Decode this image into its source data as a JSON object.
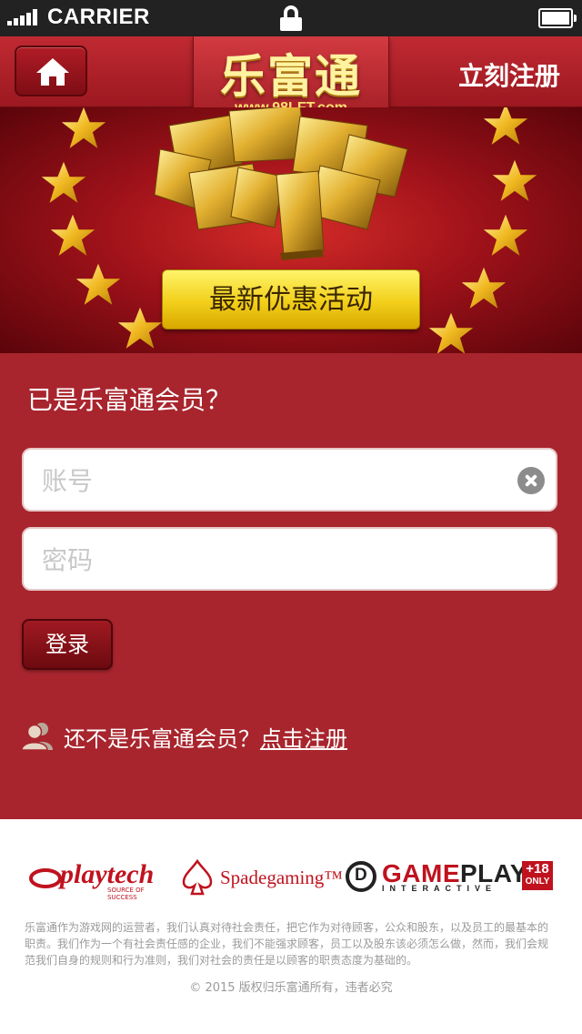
{
  "status_bar": {
    "carrier": "CARRIER"
  },
  "header": {
    "logo_text": "乐富通",
    "logo_url": "www.98LFT.com",
    "register_label": "立刻注册"
  },
  "banner": {
    "promo_label": "最新优惠活动"
  },
  "login": {
    "title": "已是乐富通会员？",
    "account_placeholder": "账号",
    "password_placeholder": "密码",
    "login_label": "登录",
    "not_member_text": "还不是乐富通会员？",
    "register_link": "点击注册"
  },
  "footer": {
    "partners": {
      "playtech": "playtech",
      "playtech_tagline": "SOURCE OF SUCCESS",
      "spadegaming": "Spadegaming™",
      "gameplay_word1": "GAME",
      "gameplay_word2": "PLAY",
      "gameplay_sub": "INTERACTIVE",
      "age_number": "+18",
      "age_label": "ONLY"
    },
    "disclaimer": "乐富通作为游戏网的运营者，我们认真对待社会责任，把它作为对待顾客，公众和股东，以及员工的最基本的职责。我们作为一个有社会责任感的企业，我们不能强求顾客，员工以及股东该必须怎么做，然而，我们会规范我们自身的规则和行为准则，我们对社会的责任是以顾客的职责态度为基础的。",
    "copyright": "© 2015 版权归乐富通所有，违者必究"
  },
  "colors": {
    "header_red": "#c02a32",
    "login_bg": "#a8252d",
    "promo_yellow": "#f2cf1a",
    "brand_red": "#c0121e"
  }
}
